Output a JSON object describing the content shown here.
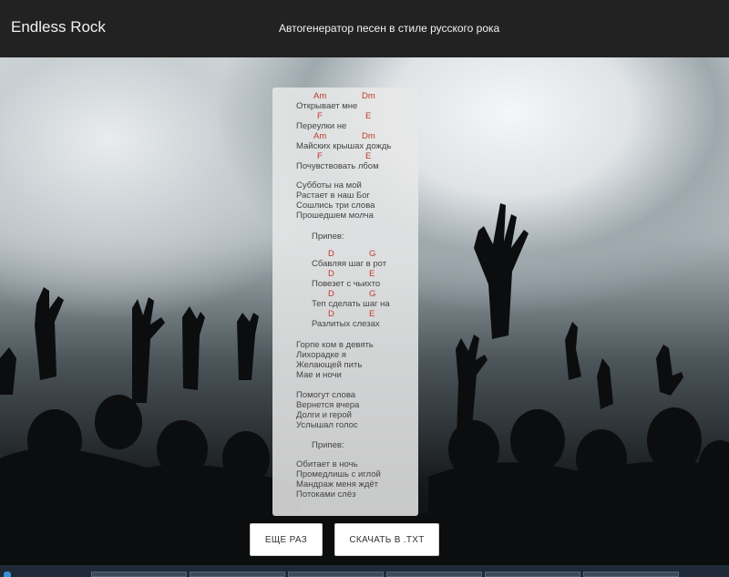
{
  "header": {
    "brand": "Endless Rock",
    "tagline": "Автогенератор песен в стиле русского рока"
  },
  "song": {
    "verse1": [
      {
        "chords": [
          "Am",
          "Dm"
        ],
        "text": "Открывает мне"
      },
      {
        "chords": [
          "F",
          "E"
        ],
        "text": "Переулки не"
      },
      {
        "chords": [
          "Am",
          "Dm"
        ],
        "text": "Майских крышах дождь"
      },
      {
        "chords": [
          "F",
          "E"
        ],
        "text": "Почувствовать лбом"
      }
    ],
    "verse2": [
      "Субботы на мой",
      "Растает в наш Бог",
      "Сошлись три слова",
      "Прошедшем молча"
    ],
    "chorus_label": "Припев:",
    "chorus": [
      {
        "chords": [
          "D",
          "G"
        ],
        "text": "Сбавляя шаг в рот"
      },
      {
        "chords": [
          "D",
          "E"
        ],
        "text": "Повезет с чьихто"
      },
      {
        "chords": [
          "D",
          "G"
        ],
        "text": "Теп сделать шаг на"
      },
      {
        "chords": [
          "D",
          "E"
        ],
        "text": "Разлитых слезах"
      }
    ],
    "verse3": [
      "Горпе ком в девять",
      "Лихорадке я",
      "Желающей пить",
      "Мае и ночи"
    ],
    "verse4": [
      "Помогут слова",
      "Вернется вчера",
      "Долги и герой",
      "Услышал голос"
    ],
    "chorus2_label": "Припев:",
    "verse5": [
      "Обитает в ночь",
      "Промедлишь с иглой",
      "Мандраж меня ждёт",
      "Потоками слёз"
    ]
  },
  "buttons": {
    "again": "ЕЩЕ РАЗ",
    "download": "СКАЧАТЬ В .TXT"
  },
  "colors": {
    "chord": "#c0392b",
    "header_bg": "#222222"
  }
}
